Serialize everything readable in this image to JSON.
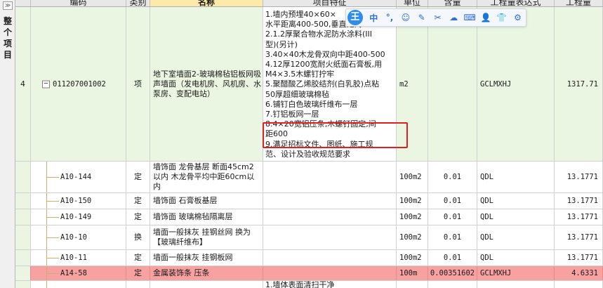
{
  "sidebar": {
    "collapse_label": "≫",
    "title": "整个项目"
  },
  "columns": {
    "code": "编码",
    "category": "类别",
    "name": "名称",
    "features": "项目特征",
    "unit": "单位",
    "content": "含量",
    "expression": "工程量表达式",
    "quantity": "工程量"
  },
  "main_row": {
    "index": "4",
    "expand_symbol": "−",
    "code": "011207001002",
    "category": "项",
    "name": "地下室墙面2-玻璃棉毡铝板网吸声墙面（发电机房、风机房、水泵房、变配电站）",
    "features": "1.墙内预埋40×60×\n水平距离400-500,垂直距离400\n2.1.2厚聚合物水泥防水涂料(III\n型)(另计)\n3.40×40木龙骨双向中距400-500\n4.12厚1200宽耐火纸面石膏板,用\nM4×3.5木螺钉拧牢\n5.聚醋酸乙烯胶结剂(白乳胶)点粘\n50厚超细玻璃棉毡\n6.铺钉白色玻璃纤维布一层\n7.钉铝板网一层\n8.4×20宽铝压条,木螺钉固定,间\n距600\n9.满足招标文件、图纸、施工规\n范、设计及验收规范要求",
    "unit": "m2",
    "content": "",
    "expression": "GCLMXHJ",
    "quantity": "1317.71"
  },
  "sub_rows": [
    {
      "code": "A10-144",
      "category": "定",
      "name": "墙饰面 龙骨基层 断面45cm2以内 木龙骨平均中距60cm以内",
      "unit": "100m2",
      "content": "0.01",
      "expression": "QDL",
      "quantity": "13.1771"
    },
    {
      "code": "A10-150",
      "category": "定",
      "name": "墙饰面 石膏板基层",
      "unit": "100m2",
      "content": "0.01",
      "expression": "QDL",
      "quantity": "13.1771"
    },
    {
      "code": "A10-149",
      "category": "定",
      "name": "墙饰面 玻璃棉毡隔离层",
      "unit": "100m2",
      "content": "0.01",
      "expression": "QDL",
      "quantity": "13.1771"
    },
    {
      "code": "A10-10",
      "category": "换",
      "name": "墙面一般抹灰 挂钢丝网 换为【玻璃纤维布】",
      "unit": "100m2",
      "content": "0.01",
      "expression": "QDL",
      "quantity": "13.1771"
    },
    {
      "code": "A10-11",
      "category": "定",
      "name": "墙面一般抹灰 挂钢板网",
      "unit": "100m2",
      "content": "0.01",
      "expression": "QDL",
      "quantity": "13.1771"
    },
    {
      "code": "A14-58",
      "category": "定",
      "name": "金属装饰条 压条",
      "unit": "100m",
      "content": "0.00351602",
      "expression": "GCLMXHJ",
      "quantity": "4.6331"
    }
  ],
  "last_row": {
    "features": "1.墙体表面清扫干净"
  },
  "toolbar": {
    "logo": "王",
    "chinese": "中",
    "punct": "°,",
    "emoji": "☺",
    "pen": "✎",
    "scissors": "✂",
    "cloud": "☁",
    "keyboard": "⌨",
    "person": "👤",
    "shirt": "👕",
    "gear": "⚙"
  },
  "colors": {
    "highlight_row": "#f7a1a1",
    "main_row_bg": "#eaf6e2",
    "red_box": "#e02020",
    "header_highlight": "#fde9a9"
  }
}
